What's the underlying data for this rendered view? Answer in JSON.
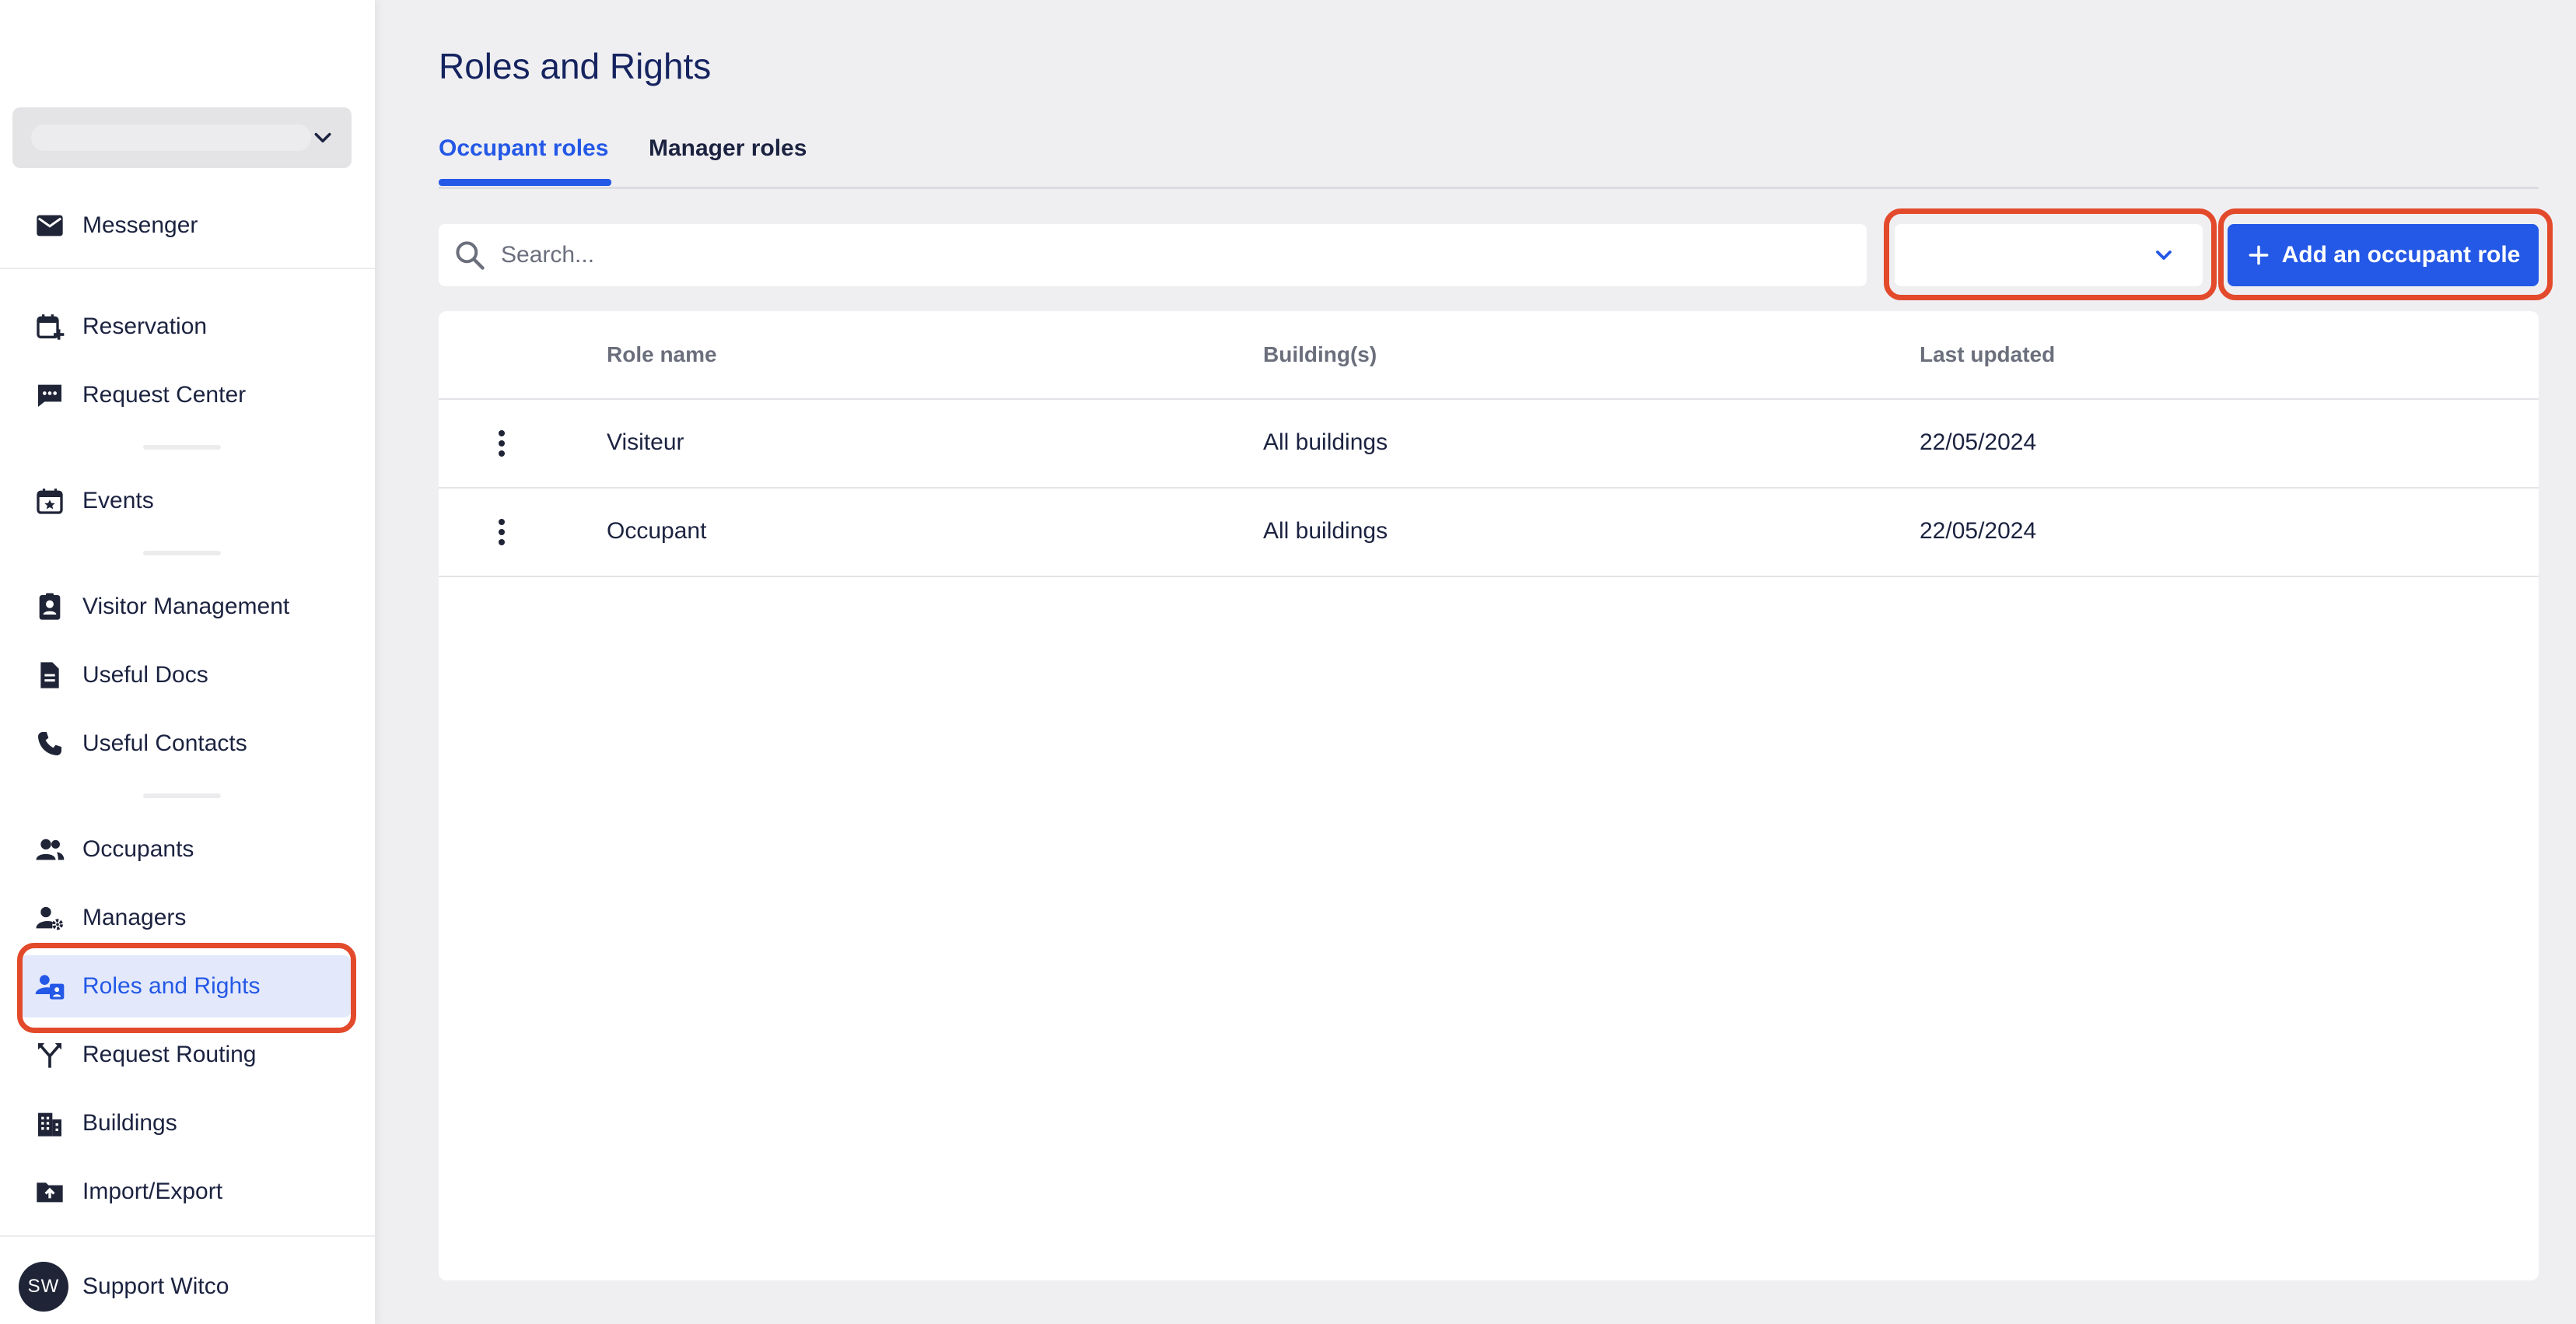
{
  "sidebar": {
    "items": [
      {
        "label": "Messenger",
        "icon": "envelope-icon"
      },
      {
        "label": "Reservation",
        "icon": "calendar-plus-icon"
      },
      {
        "label": "Request Center",
        "icon": "chat-dots-icon"
      },
      {
        "label": "Events",
        "icon": "calendar-star-icon"
      },
      {
        "label": "Visitor Management",
        "icon": "visitor-badge-icon"
      },
      {
        "label": "Useful Docs",
        "icon": "document-icon"
      },
      {
        "label": "Useful Contacts",
        "icon": "phone-icon"
      },
      {
        "label": "Occupants",
        "icon": "people-icon"
      },
      {
        "label": "Managers",
        "icon": "user-gear-icon"
      },
      {
        "label": "Roles and Rights",
        "icon": "roles-icon"
      },
      {
        "label": "Request Routing",
        "icon": "routing-icon"
      },
      {
        "label": "Buildings",
        "icon": "building-icon"
      },
      {
        "label": "Import/Export",
        "icon": "import-export-icon"
      }
    ],
    "active_item": "Roles and Rights",
    "user": {
      "initials": "SW",
      "name": "Support Witco"
    }
  },
  "page": {
    "title": "Roles and Rights",
    "tabs": [
      {
        "label": "Occupant roles",
        "active": true
      },
      {
        "label": "Manager roles",
        "active": false
      }
    ]
  },
  "toolbar": {
    "search_placeholder": "Search...",
    "add_button_label": "Add an occupant role"
  },
  "table": {
    "headers": [
      "Role name",
      "Building(s)",
      "Last updated"
    ],
    "rows": [
      {
        "role_name": "Visiteur",
        "buildings": "All buildings",
        "last_updated": "22/05/2024"
      },
      {
        "role_name": "Occupant",
        "buildings": "All buildings",
        "last_updated": "22/05/2024"
      }
    ]
  },
  "colors": {
    "accent": "#2458e6",
    "highlight": "#e34a2c",
    "title": "#15235f",
    "background": "#efeff2"
  }
}
